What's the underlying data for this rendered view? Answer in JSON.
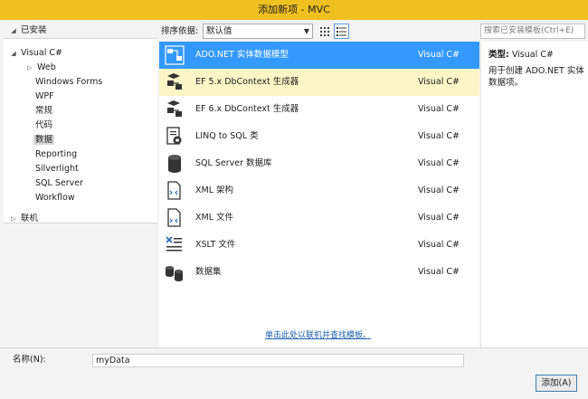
{
  "window": {
    "title": "添加新项 - MVC"
  },
  "tree": {
    "installed_label": "已安装",
    "nodes": [
      {
        "label": "Visual C#",
        "expander": "◢"
      },
      {
        "label": "Web",
        "expander": "▷"
      },
      {
        "label": "Windows Forms",
        "expander": ""
      },
      {
        "label": "WPF",
        "expander": ""
      },
      {
        "label": "常规",
        "expander": ""
      },
      {
        "label": "代码",
        "expander": ""
      },
      {
        "label": "数据",
        "expander": ""
      },
      {
        "label": "Reporting",
        "expander": ""
      },
      {
        "label": "Silverlight",
        "expander": ""
      },
      {
        "label": "SQL Server",
        "expander": ""
      },
      {
        "label": "Workflow",
        "expander": ""
      }
    ],
    "online_label": "联机"
  },
  "toolbar": {
    "sort_label": "排序依据:",
    "sort_value": "默认值",
    "search_placeholder": "搜索已安装模板(Ctrl+E)"
  },
  "templates": [
    {
      "name": "ADO.NET 实体数据模型",
      "lang": "Visual C#",
      "icon": "entity-model-icon"
    },
    {
      "name": "EF 5.x DbContext 生成器",
      "lang": "Visual C#",
      "icon": "dbcontext-generator-icon"
    },
    {
      "name": "EF 6.x DbContext 生成器",
      "lang": "Visual C#",
      "icon": "dbcontext-generator-icon"
    },
    {
      "name": "LINQ to SQL 类",
      "lang": "Visual C#",
      "icon": "linq-to-sql-icon"
    },
    {
      "name": "SQL Server 数据库",
      "lang": "Visual C#",
      "icon": "database-icon"
    },
    {
      "name": "XML 架构",
      "lang": "Visual C#",
      "icon": "xml-schema-icon"
    },
    {
      "name": "XML 文件",
      "lang": "Visual C#",
      "icon": "xml-file-icon"
    },
    {
      "name": "XSLT 文件",
      "lang": "Visual C#",
      "icon": "xslt-file-icon"
    },
    {
      "name": "数据集",
      "lang": "Visual C#",
      "icon": "dataset-icon"
    }
  ],
  "online_link": "单击此处以联机并查找模板。",
  "details": {
    "type_key": "类型:",
    "type_value": "Visual C#",
    "description": "用于创建 ADO.NET 实体数据项。"
  },
  "bottom": {
    "name_label": "名称(N):",
    "name_value": "myData",
    "add_label": "添加(A)"
  },
  "colors": {
    "title_bar": "#f0c020",
    "selection": "#3399ff",
    "hover": "#fdf5c5"
  }
}
